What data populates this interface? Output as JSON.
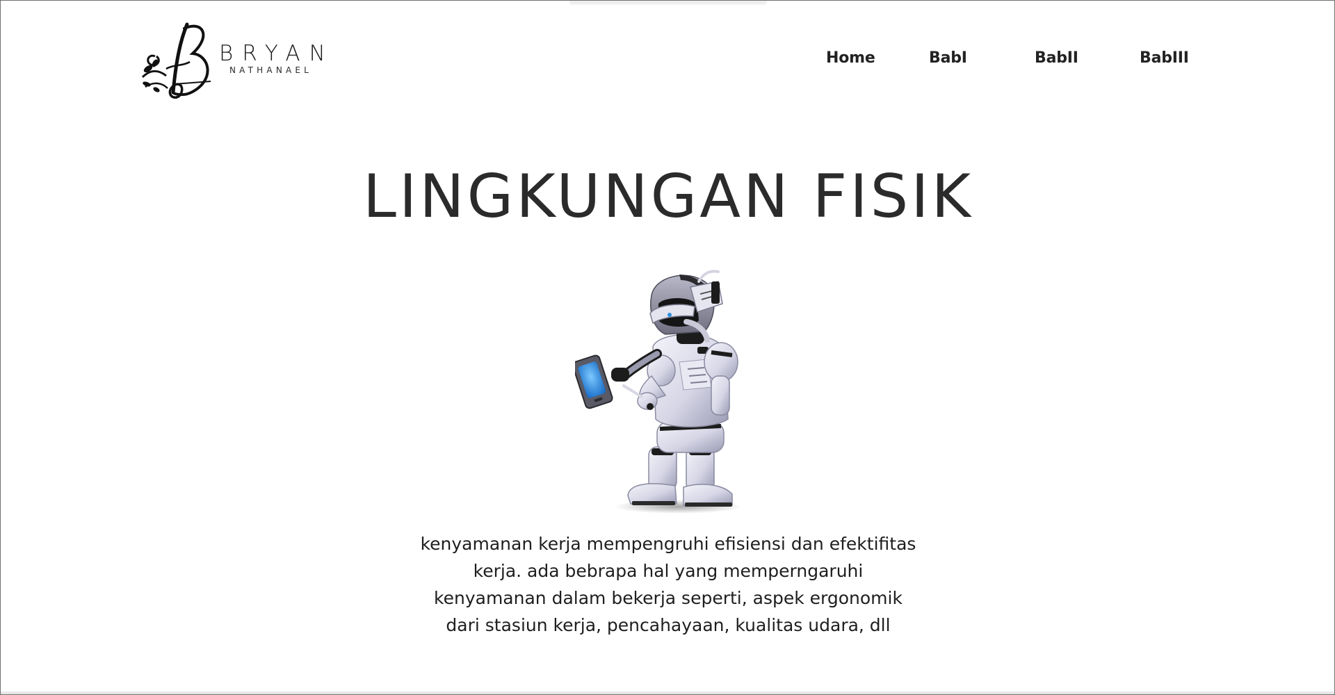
{
  "logo": {
    "name": "BRYAN",
    "subtitle": "NATHANAEL"
  },
  "nav": {
    "items": [
      {
        "label": "Home"
      },
      {
        "label": "BabI"
      },
      {
        "label": "BabII"
      },
      {
        "label": "BabIII"
      }
    ]
  },
  "main": {
    "title": "LINGKUNGAN FISIK",
    "image_alt": "robot-holding-tablet",
    "description": "kenyamanan kerja mempengruhi efisiensi dan efektifitas\nkerja. ada bebrapa hal yang memperngaruhi\nkenyamanan dalam bekerja seperti, aspek ergonomik\ndari stasiun kerja, pencahayaan, kualitas udara, dll"
  },
  "colors": {
    "text": "#262626",
    "nav_text": "#222222",
    "background": "#ffffff",
    "robot_body": "#d9d9e6",
    "robot_dark": "#1c1c1c",
    "screen_blue": "#2f8fe0"
  }
}
